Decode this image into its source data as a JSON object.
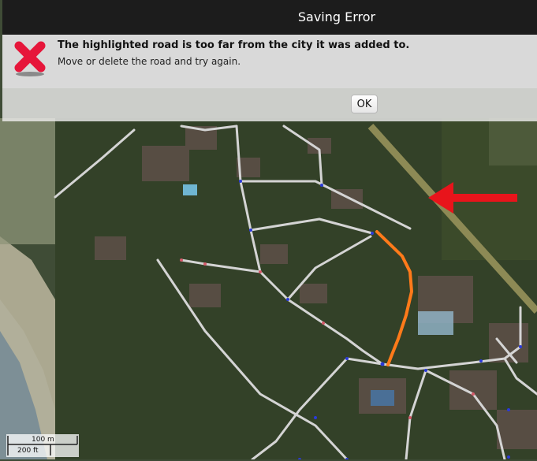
{
  "dialog": {
    "title": "Saving Error",
    "message_bold": "The highlighted road is too far from the city it was added to.",
    "message_sub": "Move or delete the road and try again.",
    "ok_label": "OK",
    "icon": "error-x-icon"
  },
  "map": {
    "scale_metric": "100 m",
    "scale_imperial": "200 ft"
  },
  "colors": {
    "highlight_road": "#ff7a1a",
    "arrow": "#e8141b",
    "road": "#d4d4d4",
    "title_bar": "#1c1c1c"
  }
}
